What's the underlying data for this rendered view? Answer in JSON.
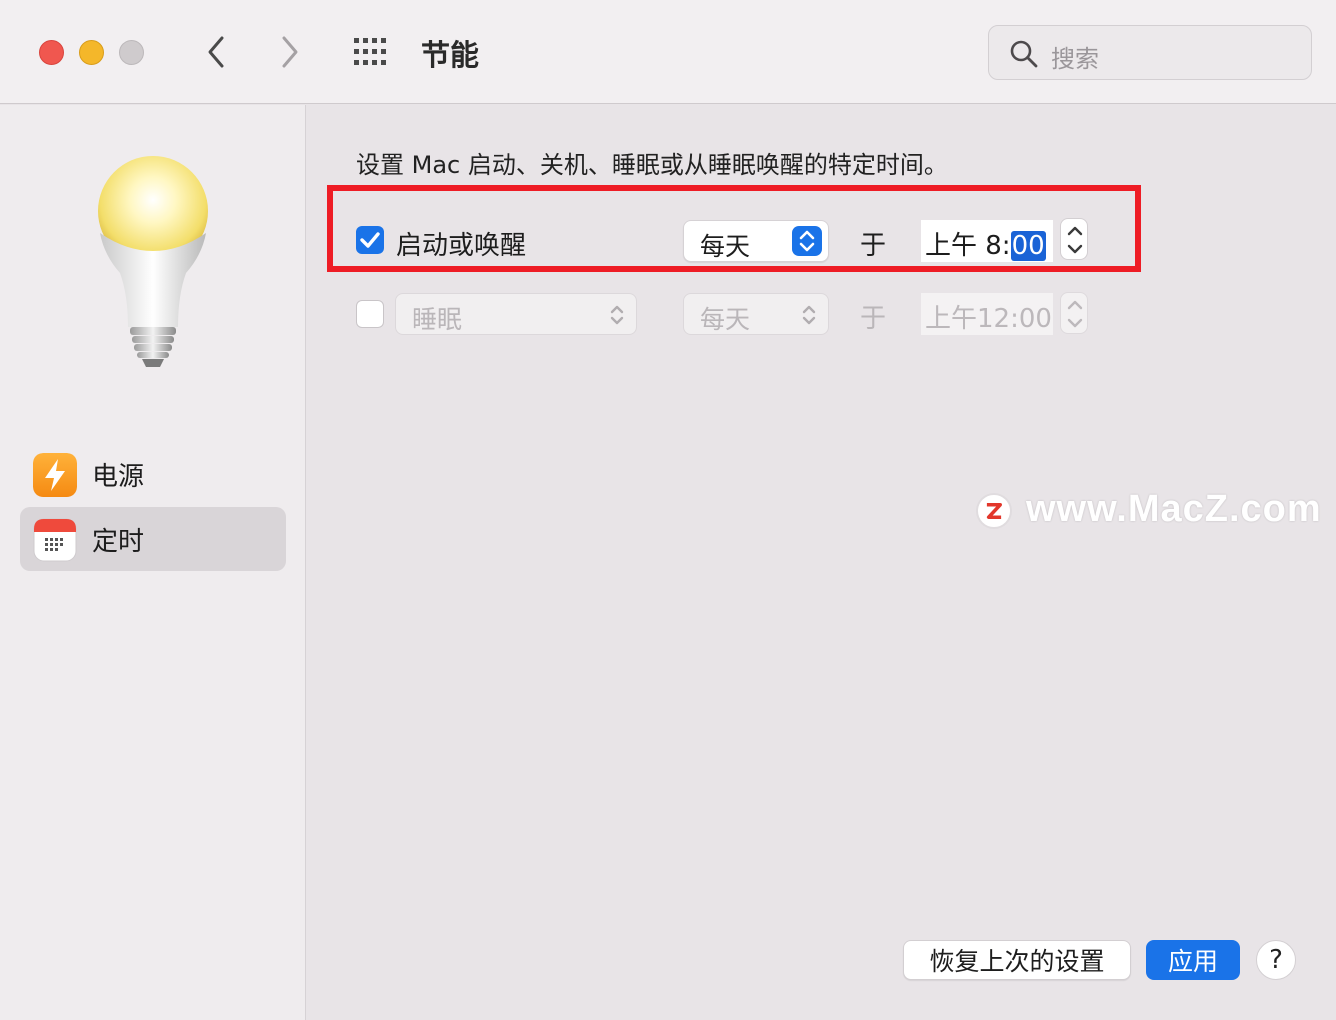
{
  "window": {
    "title": "节能",
    "search_placeholder": "搜索"
  },
  "sidebar": {
    "items": [
      {
        "label": "电源",
        "icon": "lightning-icon",
        "selected": false
      },
      {
        "label": "定时",
        "icon": "calendar-icon",
        "selected": true
      }
    ]
  },
  "main": {
    "description": "设置 Mac 启动、关机、睡眠或从睡眠唤醒的特定时间。",
    "wake_row": {
      "enabled": true,
      "label": "启动或唤醒",
      "frequency": "每天",
      "at_label": "于",
      "time_prefix": "上午  8:",
      "time_minutes": "00"
    },
    "sleep_row": {
      "enabled": false,
      "type": "睡眠",
      "frequency": "每天",
      "at_label": "于",
      "time": "上午12:00"
    }
  },
  "watermark": "www.MacZ.com",
  "buttons": {
    "revert": "恢复上次的设置",
    "apply": "应用",
    "help": "?"
  },
  "colors": {
    "accent": "#1a73e8",
    "highlight_box": "#ee1c25"
  }
}
